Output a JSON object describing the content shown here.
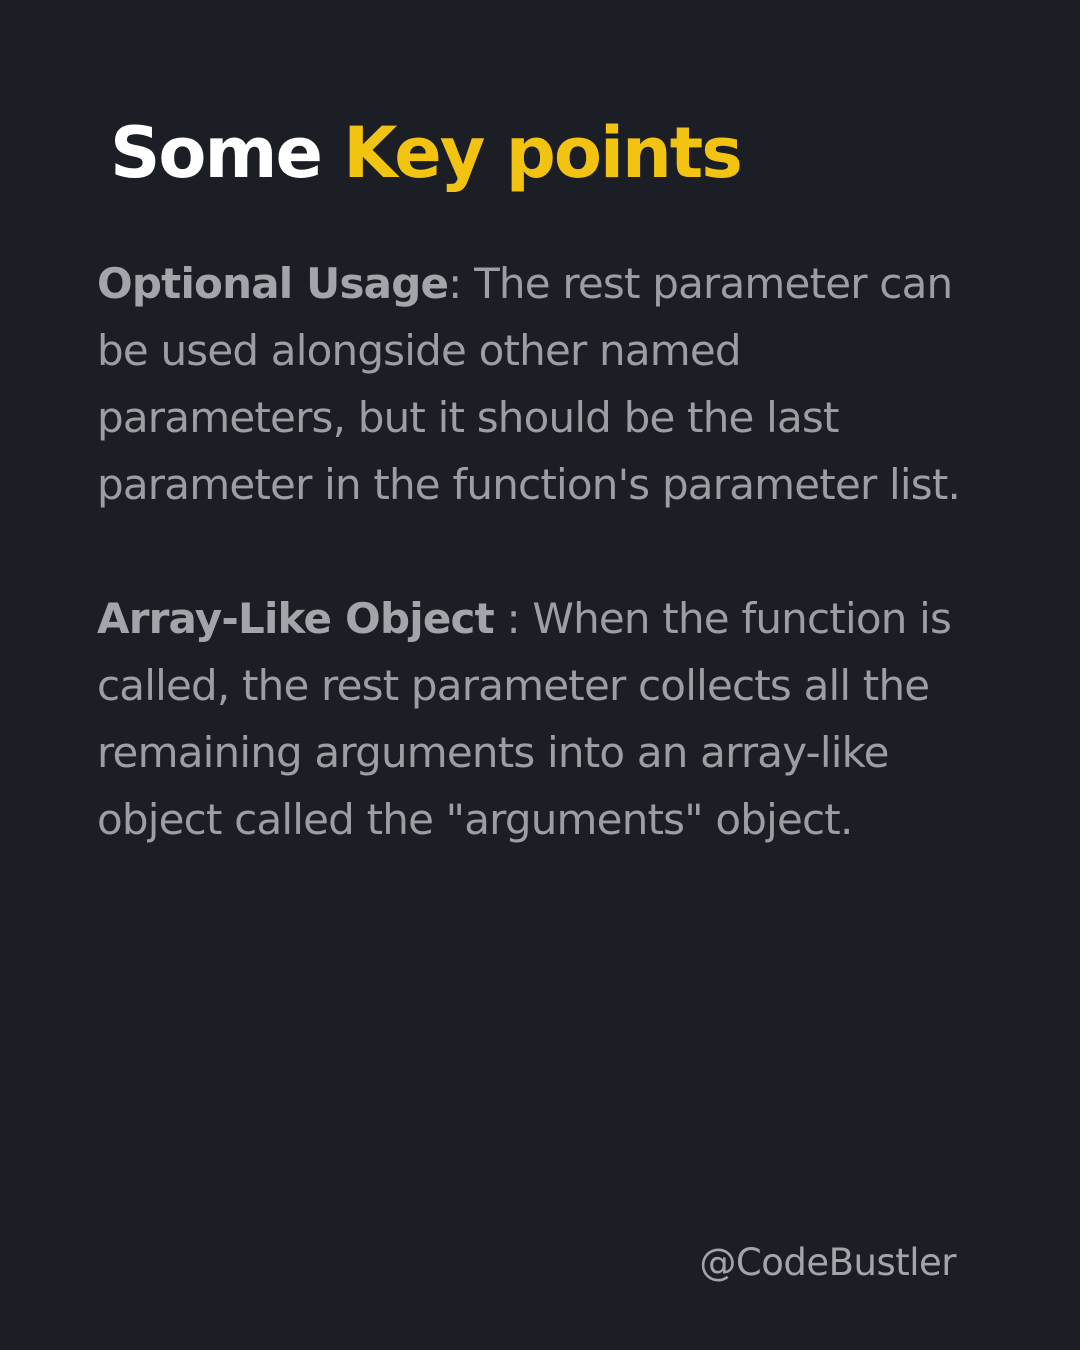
{
  "title": {
    "part_white": "Some",
    "part_yellow": "Key points"
  },
  "points": [
    {
      "term": "Optional Usage",
      "separator": ":",
      "text": " The rest parameter can be used alongside other named parameters, but it should be the last parameter in the function's parameter list."
    },
    {
      "term": "Array-Like Object",
      "separator": " :",
      "text": " When the function is called, the rest parameter collects all the remaining arguments into an array-like object called the \"arguments\" object."
    }
  ],
  "footer": {
    "handle": "@CodeBustler"
  },
  "colors": {
    "background": "#1b1e24",
    "title_white": "#ffffff",
    "accent_yellow": "#f2c311",
    "body_text": "#9c9ea3"
  }
}
